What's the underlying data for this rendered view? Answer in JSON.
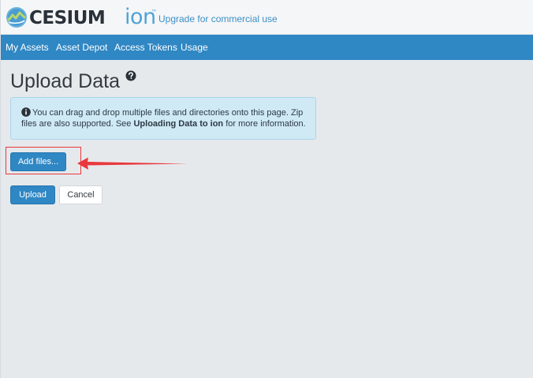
{
  "header": {
    "logo_word": "CESIUM",
    "logo_ion": "ion",
    "logo_tm": "™",
    "upgrade_link": "Upgrade for commercial use"
  },
  "nav": {
    "items": [
      {
        "label": "My Assets"
      },
      {
        "label": "Asset Depot"
      },
      {
        "label": "Access Tokens"
      },
      {
        "label": "Usage"
      }
    ]
  },
  "main": {
    "title": "Upload Data",
    "info": {
      "text_before": "You can drag and drop multiple files and directories onto this page. Zip files are also supported. See ",
      "link_text": "Uploading Data to ion",
      "text_after": " for more information."
    },
    "add_files_label": "Add files...",
    "upload_label": "Upload",
    "cancel_label": "Cancel"
  },
  "colors": {
    "nav_bg": "#2f87c4",
    "primary_button": "#2f87c4",
    "info_bg": "#cfe9f5",
    "annotation_red": "#e8383d",
    "page_bg": "#e6e9ec"
  },
  "icons": {
    "logo": "cesium-logo-icon",
    "help": "question-circle-icon",
    "info": "info-circle-icon",
    "annotation": "red-arrow-icon"
  }
}
